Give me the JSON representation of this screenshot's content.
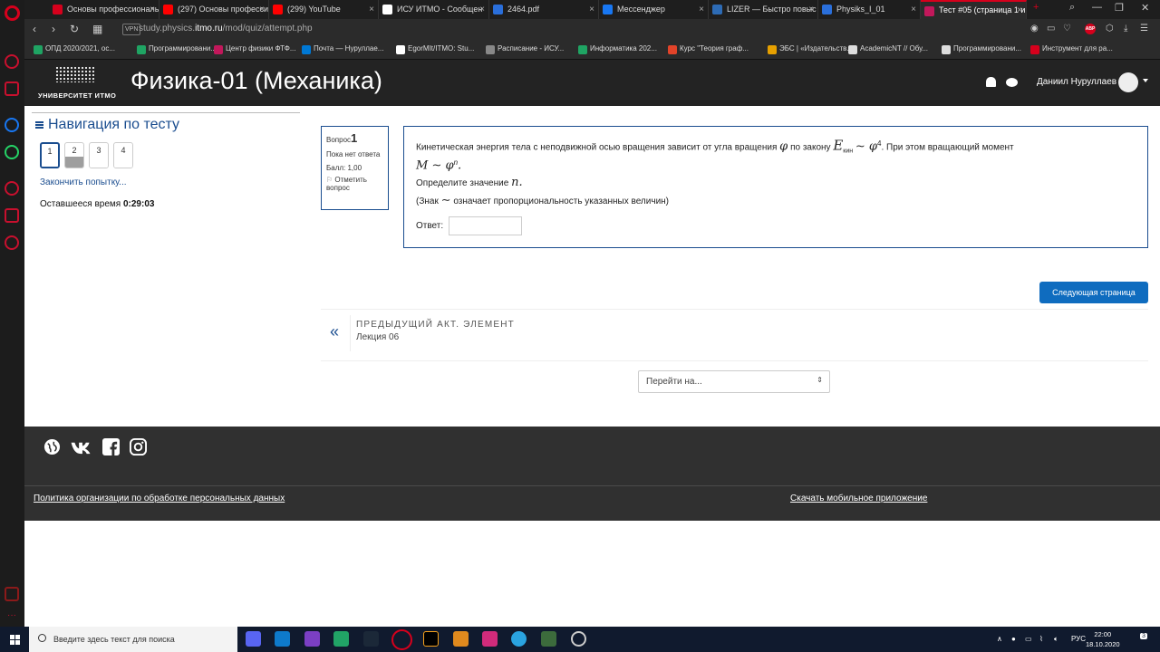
{
  "browser": {
    "tabs": [
      {
        "title": "Основы профессиональ",
        "color": "#d6001c",
        "icon": "bt-icon"
      },
      {
        "title": "(297) Основы профессиональ",
        "color": "#ff0000",
        "icon": "youtube-icon"
      },
      {
        "title": "(299) YouTube",
        "color": "#ff0000",
        "icon": "youtube-icon"
      },
      {
        "title": "ИСУ ИТМО - Сообщен",
        "color": "#ffffff",
        "icon": "mail-icon"
      },
      {
        "title": "2464.pdf",
        "color": "#2a6fdb",
        "icon": "pdf-icon"
      },
      {
        "title": "Мессенджер",
        "color": "#1877f2",
        "icon": "messenger-icon"
      },
      {
        "title": "LIZER — Быстро повыс",
        "color": "#2d6bb5",
        "icon": "vk-icon"
      },
      {
        "title": "Physiks_I_01",
        "color": "#2a6fdb",
        "icon": "document-icon"
      },
      {
        "title": "Тест #05 (страница 1 и",
        "color": "#c2185b",
        "icon": "ph-icon"
      }
    ],
    "url_prefix": "study.physics.",
    "url_domain": "itmo.ru",
    "url_path": "/mod/quiz/attempt.php",
    "vpn_label": "VPN",
    "adblock_label": "ABP",
    "bookmarks": [
      {
        "label": "ОПД 2020/2021, ос...",
        "color": "#1fa463"
      },
      {
        "label": "Программировани...",
        "color": "#1fa463"
      },
      {
        "label": "Центр физики ФТФ...",
        "color": "#c2185b"
      },
      {
        "label": "Почта — Нуруллае...",
        "color": "#0078d4"
      },
      {
        "label": "EgorMIt/ITMO: Stu...",
        "color": "#ffffff"
      },
      {
        "label": "Расписание - ИСУ...",
        "color": "#888888"
      },
      {
        "label": "Информатика 202...",
        "color": "#1fa463"
      },
      {
        "label": "Курс \"Теория граф...",
        "color": "#e24329"
      },
      {
        "label": "ЭБС | «Издательств...",
        "color": "#e6a000"
      },
      {
        "label": "AcademicNT // Обу...",
        "color": "#dddddd"
      },
      {
        "label": "Программировани...",
        "color": "#dddddd"
      },
      {
        "label": "Инструмент для ра...",
        "color": "#d6001c"
      }
    ]
  },
  "header": {
    "logo_text": "УНИВЕРСИТЕТ ИТМО",
    "course_title": "Физика-01 (Механика)",
    "user_name": "Даниил Нуруллаев"
  },
  "quiz_nav": {
    "title": "Навигация по тесту",
    "questions": [
      {
        "num": "1",
        "state": "current",
        "fill": "#ffffff"
      },
      {
        "num": "2",
        "state": "answered",
        "fill": "#9e9e9e"
      },
      {
        "num": "3",
        "state": "empty",
        "fill": "#ffffff"
      },
      {
        "num": "4",
        "state": "empty",
        "fill": "#ffffff"
      }
    ],
    "finish_link": "Закончить попытку...",
    "time_left_label": "Оставшееся время",
    "time_left_value": "0:29:03"
  },
  "question": {
    "label": "Вопрос",
    "number": "1",
    "status": "Пока нет ответа",
    "mark": "Балл: 1,00",
    "flag": "Отметить вопрос",
    "text_1": "Кинетическая энергия тела с неподвижной осью вращения зависит от угла вращения",
    "phi": "φ",
    "text_2": "по закону",
    "formula_E": "E",
    "formula_sub": "кин",
    "formula_rest": "∼ φ",
    "formula_exp": "4",
    "text_3": ". При этом вращающий момент",
    "formula_M": "M ∼ φ",
    "formula_M_exp": "n",
    "formula_M_end": ".",
    "text_4": "Определите значение",
    "n_symbol": "n",
    "n_end": ".",
    "text_5_a": "(Знак",
    "tilde": "∼",
    "text_5_b": "означает пропорциональность указанных величин)",
    "answer_label": "Ответ:",
    "answer_value": ""
  },
  "navigation": {
    "next_page": "Следующая страница",
    "prev_activity_label": "ПРЕДЫДУЩИЙ АКТ. ЭЛЕМЕНТ",
    "prev_activity_name": "Лекция 06",
    "jump_to": "Перейти на..."
  },
  "footer": {
    "privacy_link": "Политика организации по обработке персональных данных",
    "mobile_app_link": "Скачать мобильное приложение"
  },
  "taskbar": {
    "search_placeholder": "Введите здесь текст для поиска",
    "lang": "РУС",
    "time": "22:00",
    "date": "18.10.2020",
    "notifications": "3"
  }
}
